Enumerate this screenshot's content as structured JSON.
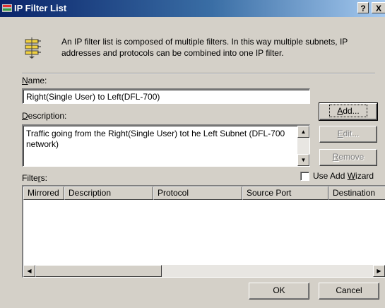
{
  "window": {
    "title": "IP Filter List",
    "help_glyph": "?",
    "close_glyph": "X"
  },
  "intro": {
    "text": "An IP filter list is composed of multiple filters. In this way multiple subnets, IP addresses and protocols can be combined into one IP filter."
  },
  "name": {
    "label_access": "N",
    "label_rest": "ame:",
    "value": "Right(Single User) to Left(DFL-700)"
  },
  "description": {
    "label_access": "D",
    "label_rest": "escription:",
    "value": "Traffic going from the Right(Single User) tot he Left Subnet (DFL-700 network)"
  },
  "buttons": {
    "add_access": "A",
    "add_rest": "dd...",
    "edit_access": "E",
    "edit_rest": "dit...",
    "remove_access": "R",
    "remove_rest": "emove",
    "ok": "OK",
    "cancel": "Cancel"
  },
  "filters": {
    "label_pre": "Filte",
    "label_access": "r",
    "label_post": "s:",
    "wizard_pre": "Use Add ",
    "wizard_access": "W",
    "wizard_post": "izard",
    "wizard_checked": false,
    "columns": [
      "Mirrored",
      "Description",
      "Protocol",
      "Source Port",
      "Destination"
    ],
    "rows": []
  },
  "icons": {
    "title": "ip-filter-icon",
    "info": "filter-list-icon",
    "arrow_up": "▲",
    "arrow_down": "▼",
    "arrow_left": "◀",
    "arrow_right": "▶"
  },
  "colors": {
    "titlebar_start": "#0a246a",
    "titlebar_end": "#a6caf0",
    "dialog_face": "#d4d0c8"
  }
}
